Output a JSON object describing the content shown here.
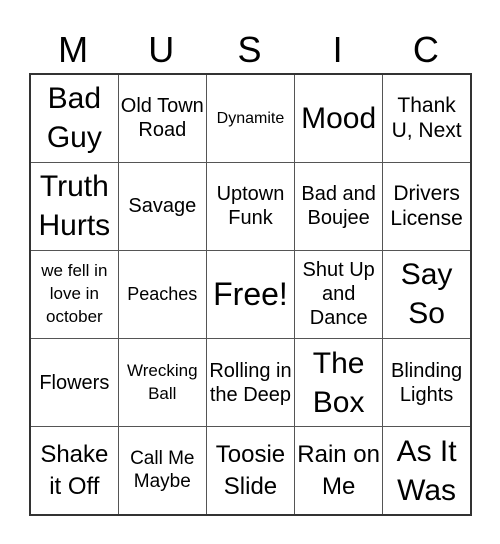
{
  "card": {
    "header": [
      "M",
      "U",
      "S",
      "I",
      "C"
    ],
    "rows": [
      [
        "Bad Guy",
        "Old Town Road",
        "Dynamite",
        "Mood",
        "Thank U, Next"
      ],
      [
        "Truth Hurts",
        "Savage",
        "Uptown Funk",
        "Bad and Boujee",
        "Drivers License"
      ],
      [
        "we fell in love in october",
        "Peaches",
        "Free!",
        "Shut Up and Dance",
        "Say So"
      ],
      [
        "Flowers",
        "Wrecking Ball",
        "Rolling in the Deep",
        "The Box",
        "Blinding Lights"
      ],
      [
        "Shake it Off",
        "Call Me Maybe",
        "Toosie Slide",
        "Rain on Me",
        "As It Was"
      ]
    ],
    "free_space": "Free!"
  },
  "colors": {
    "grid_line": "#555555",
    "text": "#000000",
    "background": "#ffffff"
  }
}
